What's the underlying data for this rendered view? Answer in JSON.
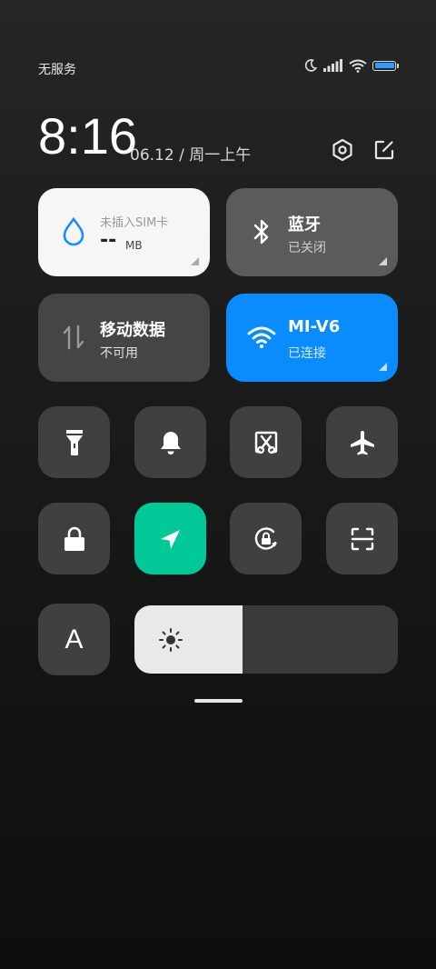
{
  "status": {
    "carrier": "无服务",
    "battery_level": 1.0,
    "icons": [
      "moon-icon",
      "signal-icon",
      "wifi-icon",
      "battery-icon"
    ]
  },
  "header": {
    "time": "8:16",
    "date": "06.12 / 周一上午",
    "icons": [
      "settings-hexagon-icon",
      "edit-icon"
    ]
  },
  "tiles": {
    "data_usage": {
      "title": "未插入SIM卡",
      "value": "--",
      "unit": "MB",
      "icon": "water-drop-icon"
    },
    "bluetooth": {
      "title": "蓝牙",
      "status": "已关闭",
      "icon": "bluetooth-icon"
    },
    "mobile_data": {
      "title": "移动数据",
      "status": "不可用",
      "icon": "up-down-arrows-icon"
    },
    "wifi": {
      "title": "MI-V6",
      "status": "已连接",
      "icon": "wifi-icon"
    }
  },
  "toggles": [
    {
      "name": "flashlight",
      "icon": "flashlight-icon",
      "active": false
    },
    {
      "name": "bell",
      "icon": "bell-icon",
      "active": false
    },
    {
      "name": "screenshot",
      "icon": "screenshot-scissors-icon",
      "active": false
    },
    {
      "name": "airplane",
      "icon": "airplane-icon",
      "active": false
    },
    {
      "name": "lock",
      "icon": "lock-icon",
      "active": false
    },
    {
      "name": "location",
      "icon": "location-arrow-icon",
      "active": true
    },
    {
      "name": "rotation-lock",
      "icon": "rotation-lock-icon",
      "active": false
    },
    {
      "name": "scanner",
      "icon": "scan-icon",
      "active": false
    },
    {
      "name": "font",
      "icon": "font-a-icon",
      "active": false
    }
  ],
  "font_toggle_label": "A",
  "brightness": {
    "level": 0.41,
    "icon": "sun-icon"
  },
  "colors": {
    "accent_blue": "#0a8cff",
    "accent_green": "#00c896",
    "tile_dark": "#565656",
    "tile_light": "#f6f6f6"
  }
}
